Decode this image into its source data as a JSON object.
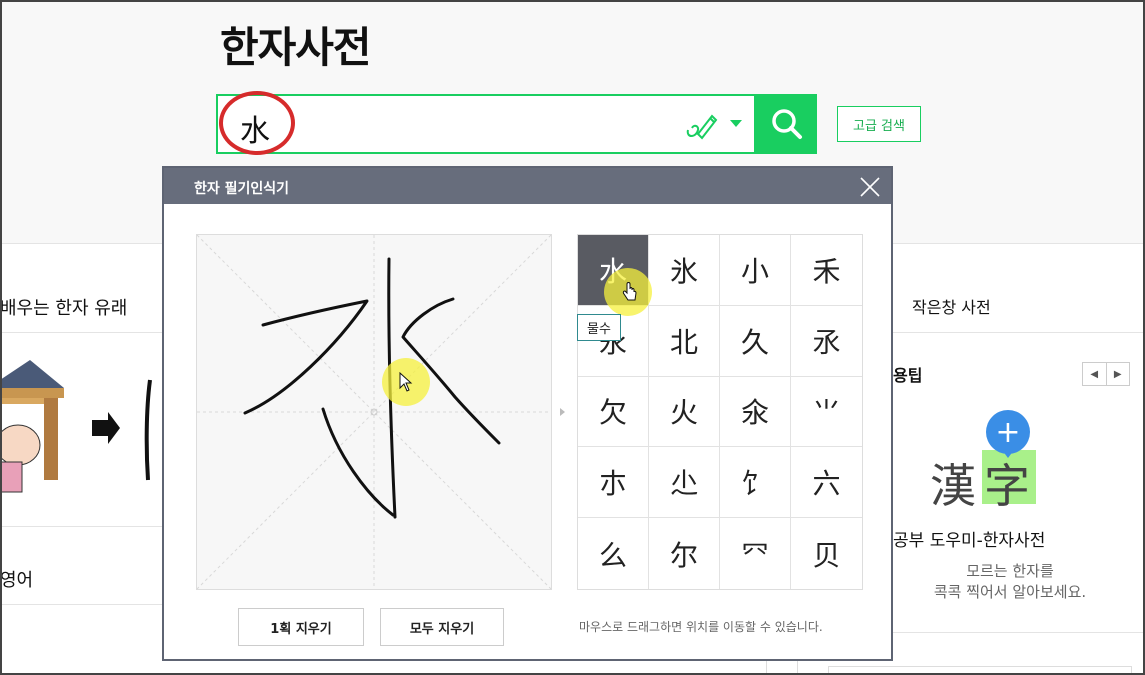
{
  "page": {
    "title": "한자사전",
    "search_value": "水",
    "advanced_search_label": "고급 검색"
  },
  "left_panel": {
    "items": [
      "배우는 한자 유래",
      "영어"
    ]
  },
  "right_panel": {
    "small_window_label": "작은창 사전",
    "tips_label": "용팁",
    "promo_title": "자 공부 도우미-한자사전",
    "promo_line1": "모르는 한자를",
    "promo_line2": "콕콕 찍어서 알아보세요.",
    "promo_hanja_1": "漢",
    "promo_hanja_2": "字",
    "nav_prev": "◀",
    "nav_next": "▶",
    "plus": "+"
  },
  "popup": {
    "title": "한자 필기인식기",
    "candidates": [
      "水",
      "氷",
      "小",
      "禾",
      "永",
      "北",
      "久",
      "氶",
      "欠",
      "火",
      "氽",
      "⺌",
      "朩",
      "尐",
      "饣",
      "六",
      "么",
      "尔",
      "⺳",
      "贝"
    ],
    "selected_index": 0,
    "tooltip": "물수",
    "erase_one_label": "1획 지우기",
    "erase_all_label": "모두 지우기",
    "hint": "마우스로 드래그하면 위치를 이동할 수 있습니다."
  },
  "colors": {
    "accent": "#19ce60",
    "popup_header": "#676d7c",
    "selected_cell": "#595b62",
    "annotation_red": "#d62b2b",
    "highlight_yellow": "#f5f03c"
  },
  "icons": [
    "pen-icon",
    "chevron-down-icon",
    "search-icon",
    "close-icon",
    "cursor-icon",
    "hand-cursor-icon",
    "plus-icon"
  ]
}
